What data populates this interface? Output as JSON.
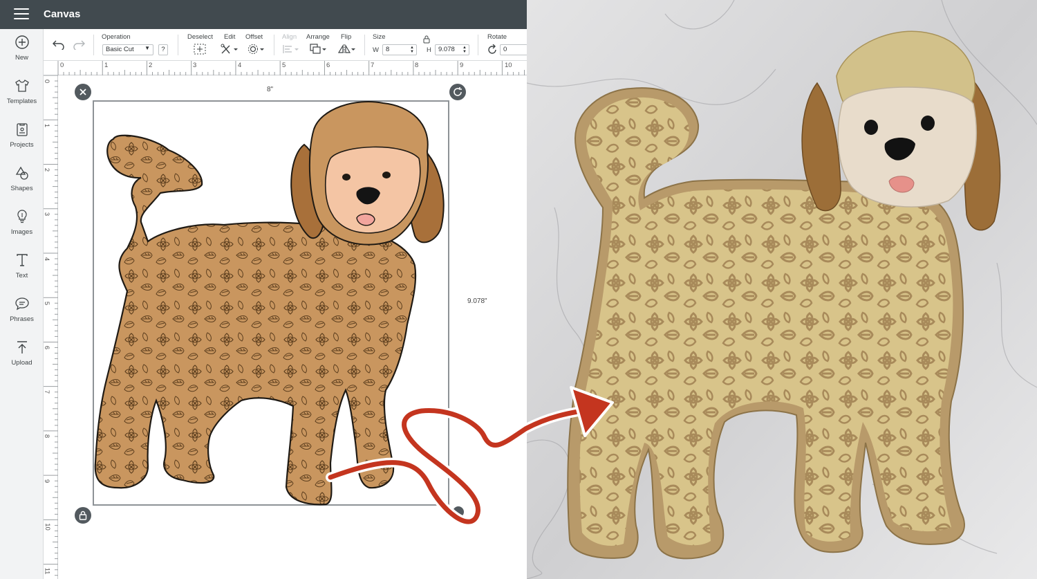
{
  "app": {
    "title": "Canvas"
  },
  "sidebar": {
    "items": [
      {
        "label": "New",
        "icon": "plus-circle-icon"
      },
      {
        "label": "Templates",
        "icon": "tshirt-icon"
      },
      {
        "label": "Projects",
        "icon": "projects-icon"
      },
      {
        "label": "Shapes",
        "icon": "shapes-icon"
      },
      {
        "label": "Images",
        "icon": "lightbulb-icon"
      },
      {
        "label": "Text",
        "icon": "text-icon"
      },
      {
        "label": "Phrases",
        "icon": "speech-bubble-icon"
      },
      {
        "label": "Upload",
        "icon": "upload-icon"
      }
    ]
  },
  "toolbar": {
    "operation_label": "Operation",
    "operation_value": "Basic Cut",
    "help": "?",
    "deselect_label": "Deselect",
    "edit_label": "Edit",
    "offset_label": "Offset",
    "align_label": "Align",
    "arrange_label": "Arrange",
    "flip_label": "Flip",
    "size_label": "Size",
    "w_label": "W",
    "w_value": "8",
    "h_label": "H",
    "h_value": "9.078",
    "rotate_label": "Rotate",
    "rotate_value": "0"
  },
  "ruler": {
    "top": [
      "0",
      "1",
      "2",
      "3",
      "4",
      "5",
      "6",
      "7",
      "8",
      "9",
      "10"
    ],
    "left": [
      "0",
      "1",
      "2",
      "3",
      "4",
      "5",
      "6",
      "7",
      "8",
      "9",
      "10",
      "11"
    ]
  },
  "canvas": {
    "width_dim": "8\"",
    "height_dim": "9.078\""
  },
  "colors": {
    "topbar": "#414a4f",
    "dog_body": "#c9965f",
    "dog_ears": "#a8703a",
    "dog_face": "#f4c5a4",
    "arrow": "#c4351f",
    "paper_kraft": "#b89a6a",
    "paper_cream": "#d8c48a"
  }
}
